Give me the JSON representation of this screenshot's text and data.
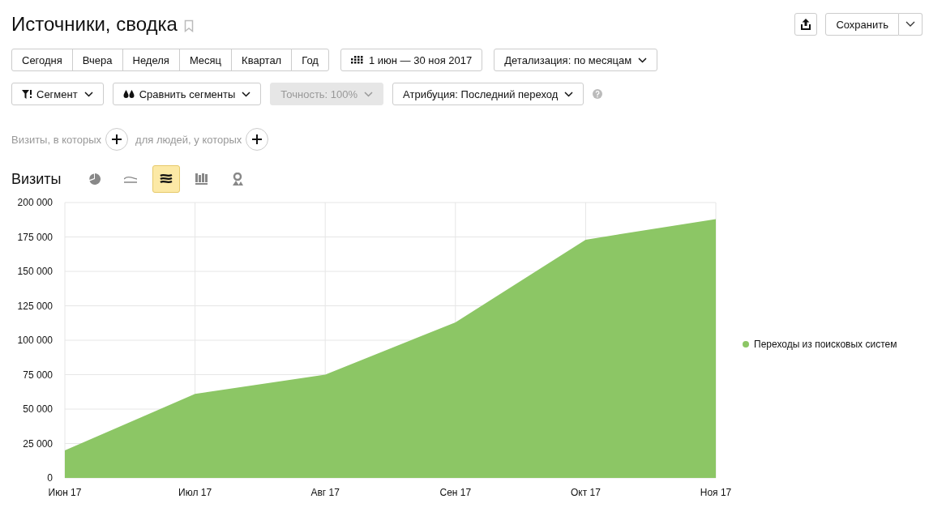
{
  "title": "Источники, сводка",
  "header_buttons": {
    "save": "Сохранить"
  },
  "periods": [
    {
      "label": "Сегодня",
      "selected": false
    },
    {
      "label": "Вчера",
      "selected": false
    },
    {
      "label": "Неделя",
      "selected": false
    },
    {
      "label": "Месяц",
      "selected": false
    },
    {
      "label": "Квартал",
      "selected": false
    },
    {
      "label": "Год",
      "selected": false
    }
  ],
  "date_range": "1 июн — 30 ноя 2017",
  "detail": "Детализация: по месяцам",
  "filters": [
    {
      "kind": "segment",
      "label": "Сегмент",
      "disabled": false
    },
    {
      "kind": "compare",
      "label": "Сравнить сегменты",
      "disabled": false
    },
    {
      "kind": "plain",
      "label": "Точность: 100%",
      "disabled": true
    },
    {
      "kind": "plain",
      "label": "Атрибуция: Последний переход",
      "disabled": false
    }
  ],
  "conditions": [
    "Визиты, в которых",
    "для людей, у которых"
  ],
  "chart_title": "Визиты",
  "chart_types": [
    {
      "kind": "pie",
      "selected": false
    },
    {
      "kind": "line",
      "selected": false
    },
    {
      "kind": "area",
      "selected": true
    },
    {
      "kind": "bar",
      "selected": false
    },
    {
      "kind": "map",
      "selected": false
    }
  ],
  "chart_data": {
    "type": "area",
    "categories": [
      "Июн 17",
      "Июл 17",
      "Авг 17",
      "Сен 17",
      "Окт 17",
      "Ноя 17"
    ],
    "series": [
      {
        "name": "Переходы из поисковых систем",
        "color": "#8cc665",
        "values": [
          20000,
          61000,
          75000,
          113000,
          173000,
          188000
        ]
      }
    ],
    "ylim": [
      0,
      200000
    ],
    "grid": true,
    "yticks": [
      {
        "value": 0,
        "label": "0"
      },
      {
        "value": 25000,
        "label": "25 000"
      },
      {
        "value": 50000,
        "label": "50 000"
      },
      {
        "value": 75000,
        "label": "75 000"
      },
      {
        "value": 100000,
        "label": "100 000"
      },
      {
        "value": 125000,
        "label": "125 000"
      },
      {
        "value": 150000,
        "label": "150 000"
      },
      {
        "value": 175000,
        "label": "175 000"
      },
      {
        "value": 200000,
        "label": "200 000"
      }
    ]
  }
}
